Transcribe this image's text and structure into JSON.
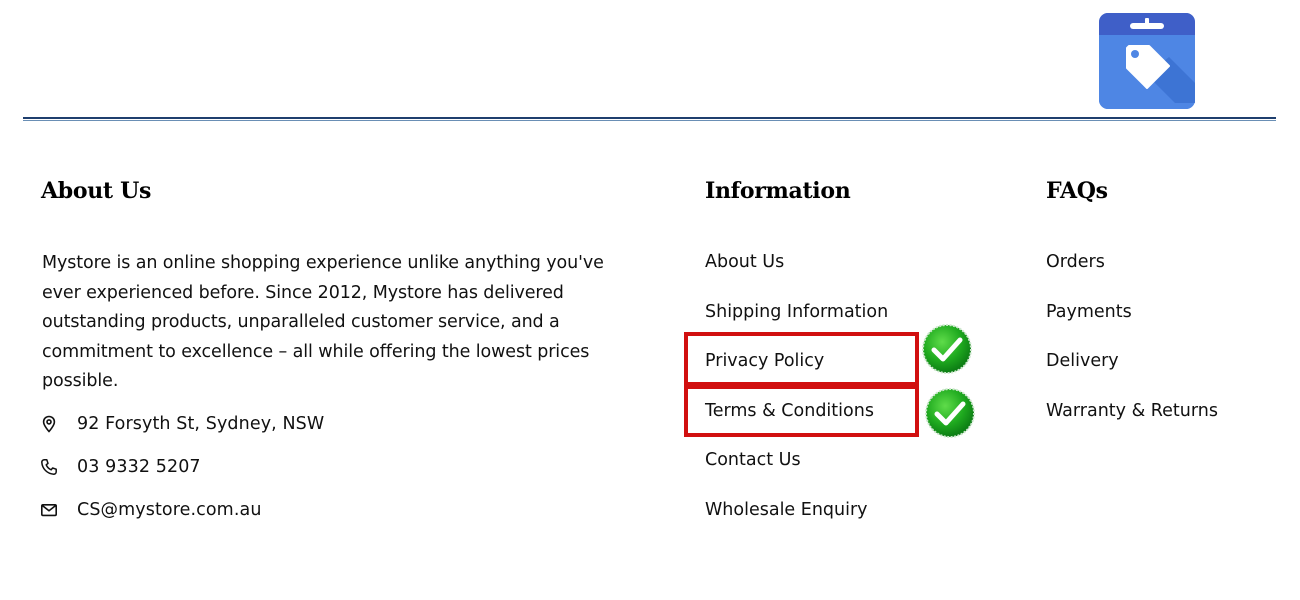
{
  "header": {
    "app_icon": "price-tag-icon"
  },
  "about": {
    "heading": "About Us",
    "description": "Mystore is an online shopping experience unlike anything you've ever experienced before. Since 2012, Mystore has delivered outstanding products, unparalleled customer service, and a commitment to excellence – all while offering the lowest prices possible.",
    "address": "92 Forsyth St, Sydney, NSW",
    "phone": "03 9332 5207",
    "email": "CS@mystore.com.au",
    "icons": [
      "location-pin-icon",
      "phone-icon",
      "envelope-icon"
    ]
  },
  "information": {
    "heading": "Information",
    "links": [
      "About Us",
      "Shipping Information",
      "Privacy Policy",
      "Terms & Conditions",
      "Contact Us",
      "Wholesale Enquiry"
    ],
    "highlighted_links": [
      "Privacy Policy",
      "Terms & Conditions"
    ],
    "badge_icon": "green-checkmark-icon"
  },
  "faqs": {
    "heading": "FAQs",
    "links": [
      "Orders",
      "Payments",
      "Delivery",
      "Warranty & Returns"
    ]
  },
  "colors": {
    "highlight_border": "#d10f0f",
    "check_green": "#1faa1f",
    "divider": "#1f3f6e",
    "icon_blue": "#4a7fe0"
  }
}
